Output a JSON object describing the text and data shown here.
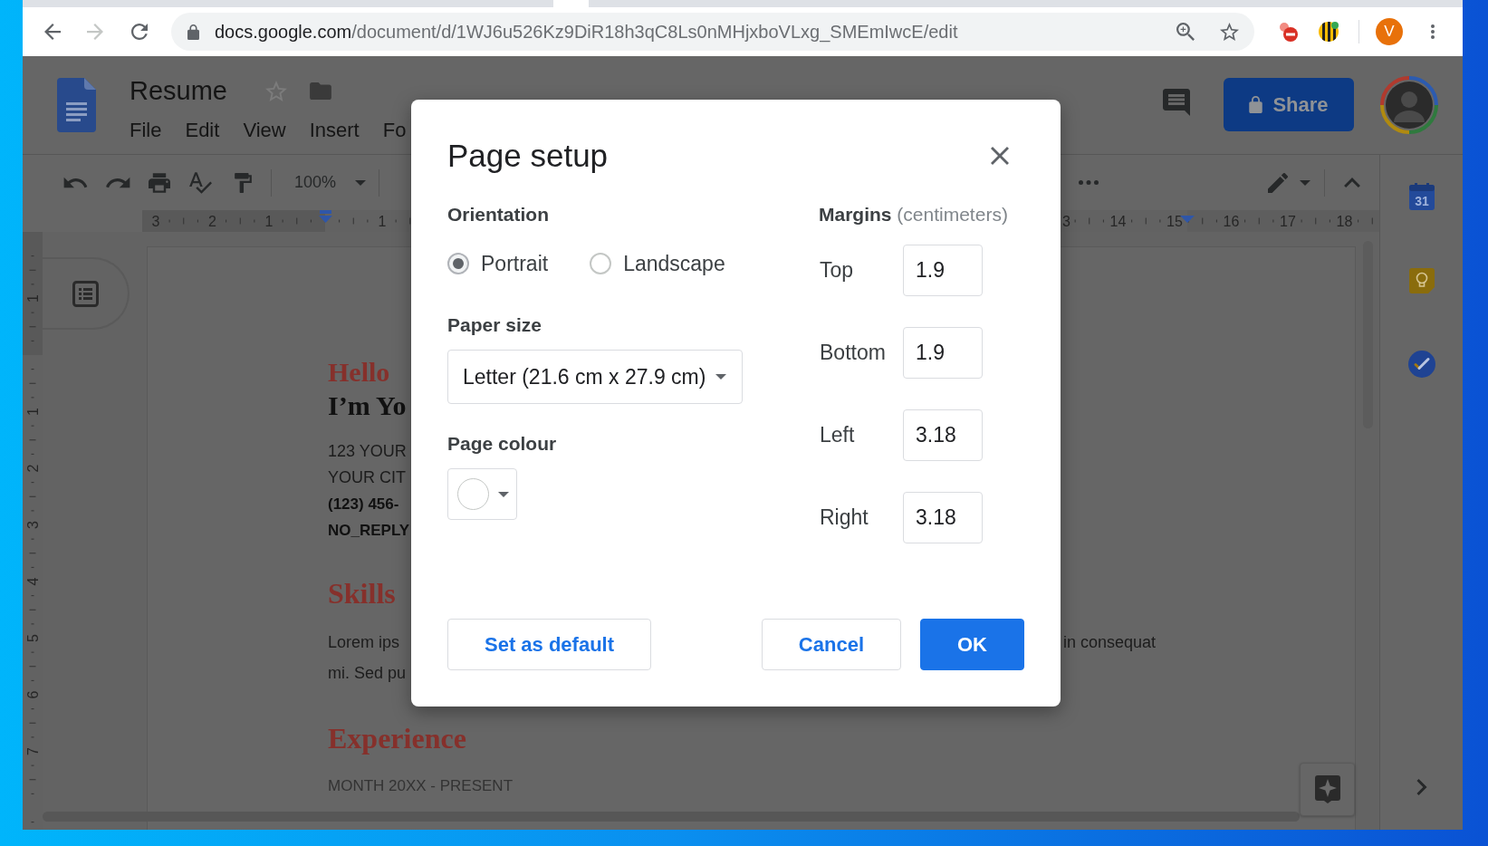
{
  "browser": {
    "forward_disabled": true,
    "url": {
      "host": "docs.google.com",
      "path": "/document/d/1WJ6u526Kz9DiR18h3qC8Ls0nMHjxboVLxg_SMEmIwcE/edit"
    },
    "profile_initial": "V"
  },
  "docs_header": {
    "title": "Resume",
    "starred": false,
    "menu": [
      "File",
      "Edit",
      "View",
      "Insert",
      "Fo"
    ],
    "share": "Share"
  },
  "toolbar": {
    "zoom": "100%"
  },
  "ruler": {
    "top_left_numbers": [
      "3",
      "2",
      "1",
      "1"
    ],
    "top_right_numbers": [
      "3",
      "14",
      "15",
      "16",
      "17",
      "18"
    ],
    "side_numbers": [
      "1",
      "1",
      "2",
      "3",
      "4",
      "5",
      "6",
      "7"
    ]
  },
  "document": {
    "blocks": [
      {
        "kind": "greeting",
        "text": "Hello"
      },
      {
        "kind": "name",
        "text": "I’m Yo"
      },
      {
        "kind": "address",
        "text": "123 YOUR"
      },
      {
        "kind": "address",
        "text": "YOUR CIT"
      },
      {
        "kind": "contact",
        "text": "(123) 456-"
      },
      {
        "kind": "contact",
        "text": "NO_REPLY"
      },
      {
        "kind": "heading",
        "text": "Skills"
      },
      {
        "kind": "body",
        "text": "Lorem ips",
        "right_part": "in consequat"
      },
      {
        "kind": "body",
        "text": "mi. Sed pu"
      },
      {
        "kind": "heading",
        "text": "Experience"
      },
      {
        "kind": "date",
        "text": "MONTH 20XX - PRESENT"
      }
    ]
  },
  "side_panel": {
    "calendar_day": "31"
  },
  "dialog": {
    "title": "Page setup",
    "orientation": {
      "label": "Orientation",
      "options": [
        {
          "label": "Portrait",
          "selected": true
        },
        {
          "label": "Landscape",
          "selected": false
        }
      ]
    },
    "paper_size": {
      "label": "Paper size",
      "value": "Letter (21.6 cm x 27.9 cm)"
    },
    "page_colour": {
      "label": "Page colour",
      "color": "#ffffff"
    },
    "margins": {
      "title": "**Margins** (centimeters)",
      "fields": [
        {
          "label": "Top",
          "value": "1.9"
        },
        {
          "label": "Bottom",
          "value": "1.9"
        },
        {
          "label": "Left",
          "value": "3.18"
        },
        {
          "label": "Right",
          "value": "3.18"
        }
      ]
    },
    "buttons": [
      {
        "label": "Set as default",
        "kind": "outlined"
      },
      {
        "label": "Cancel",
        "kind": "outlined"
      },
      {
        "label": "OK",
        "kind": "filled"
      }
    ]
  }
}
